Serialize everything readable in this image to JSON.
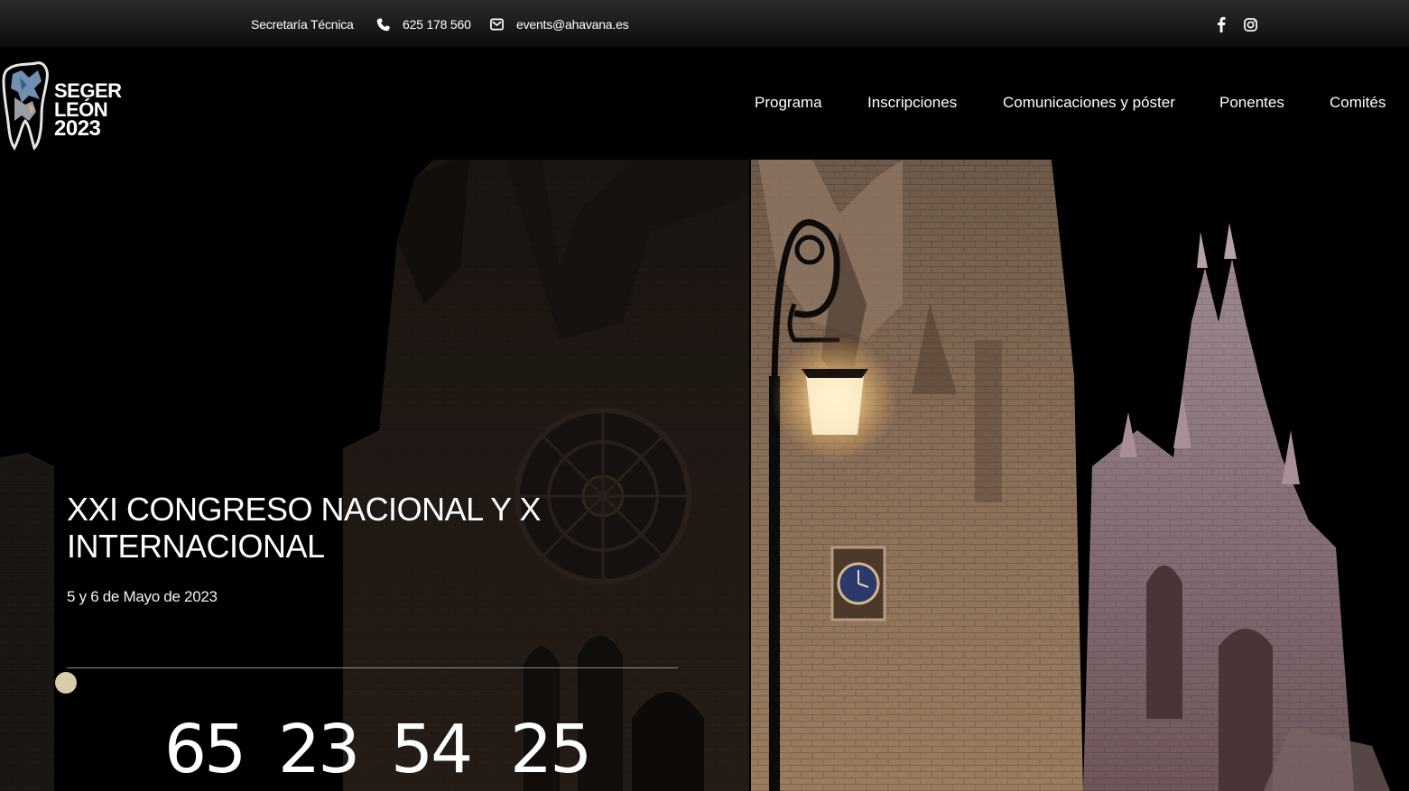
{
  "topbar": {
    "secretaria": "Secretaría Técnica",
    "phone": "625 178 560",
    "email": "events@ahavana.es"
  },
  "social": [
    {
      "icon": "facebook-icon"
    },
    {
      "icon": "instagram-icon"
    }
  ],
  "logo": {
    "line1": "SEGER",
    "line2": "LEÓN",
    "line3": "2023"
  },
  "nav": {
    "items": [
      {
        "label": "Programa"
      },
      {
        "label": "Inscripciones"
      },
      {
        "label": "Comunicaciones y póster"
      },
      {
        "label": "Ponentes"
      },
      {
        "label": "Comités"
      }
    ]
  },
  "hero": {
    "title": "XXI CONGRESO NACIONAL Y X INTERNACIONAL",
    "date": "5 y 6 de Mayo de 2023",
    "countdown": [
      "65",
      "23",
      "54",
      "25"
    ]
  },
  "colors": {
    "background": "#000000",
    "text": "#ffffff",
    "divider": "#8a8a8a"
  }
}
